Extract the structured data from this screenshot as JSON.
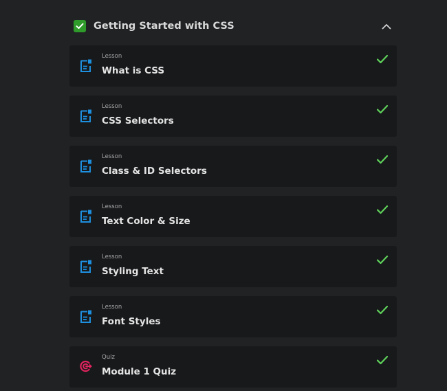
{
  "module": {
    "title": "Getting Started with CSS",
    "completed": true,
    "expanded": true
  },
  "colors": {
    "background": "#202224",
    "card": "#18191b",
    "accent_green": "#2e9b2a",
    "check_green": "#5fd35a",
    "lesson_icon": "#1e90e0",
    "quiz_icon": "#e0245e"
  },
  "items": [
    {
      "type": "Lesson",
      "title": "What is CSS",
      "icon": "document-icon",
      "completed": true
    },
    {
      "type": "Lesson",
      "title": "CSS Selectors",
      "icon": "document-icon",
      "completed": true
    },
    {
      "type": "Lesson",
      "title": "Class & ID Selectors",
      "icon": "document-icon",
      "completed": true
    },
    {
      "type": "Lesson",
      "title": "Text Color & Size",
      "icon": "document-icon",
      "completed": true
    },
    {
      "type": "Lesson",
      "title": "Styling Text",
      "icon": "document-icon",
      "completed": true
    },
    {
      "type": "Lesson",
      "title": "Font Styles",
      "icon": "document-icon",
      "completed": true
    },
    {
      "type": "Quiz",
      "title": "Module 1 Quiz",
      "icon": "target-icon",
      "completed": true
    }
  ]
}
